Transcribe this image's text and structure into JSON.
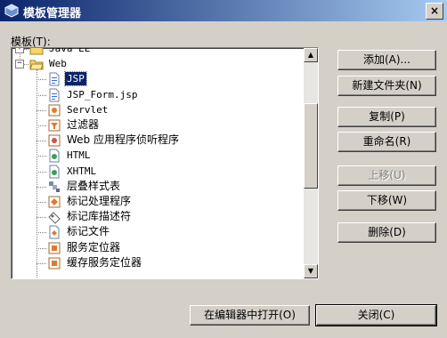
{
  "window": {
    "title": "模板管理器",
    "close_label": "×"
  },
  "tree": {
    "label": "模板(T):",
    "nodes": [
      {
        "label": "Java EE",
        "icon": "folder-icon"
      },
      {
        "label": "Web",
        "icon": "folder-open-icon"
      },
      {
        "label": "JSP",
        "icon": "jsp-file-icon",
        "selected": true
      },
      {
        "label": "JSP_Form.jsp",
        "icon": "jsp-file-icon"
      },
      {
        "label": "Servlet",
        "icon": "servlet-icon"
      },
      {
        "label": "过滤器",
        "icon": "filter-icon"
      },
      {
        "label": "Web 应用程序侦听程序",
        "icon": "listener-icon"
      },
      {
        "label": "HTML",
        "icon": "html-file-icon"
      },
      {
        "label": "XHTML",
        "icon": "html-file-icon"
      },
      {
        "label": "层叠样式表",
        "icon": "css-icon"
      },
      {
        "label": "标记处理程序",
        "icon": "tag-handler-icon"
      },
      {
        "label": "标记库描述符",
        "icon": "tld-icon"
      },
      {
        "label": "标记文件",
        "icon": "tag-file-icon"
      },
      {
        "label": "服务定位器",
        "icon": "locator-icon"
      },
      {
        "label": "缓存服务定位器",
        "icon": "locator-icon"
      }
    ]
  },
  "buttons": {
    "add": "添加(A)...",
    "new_folder": "新建文件夹(N)",
    "copy": "复制(P)",
    "rename": "重命名(R)",
    "move_up": "上移(U)",
    "move_down": "下移(W)",
    "delete": "删除(D)",
    "open_in_editor": "在编辑器中打开(O)",
    "close": "关闭(C)"
  }
}
